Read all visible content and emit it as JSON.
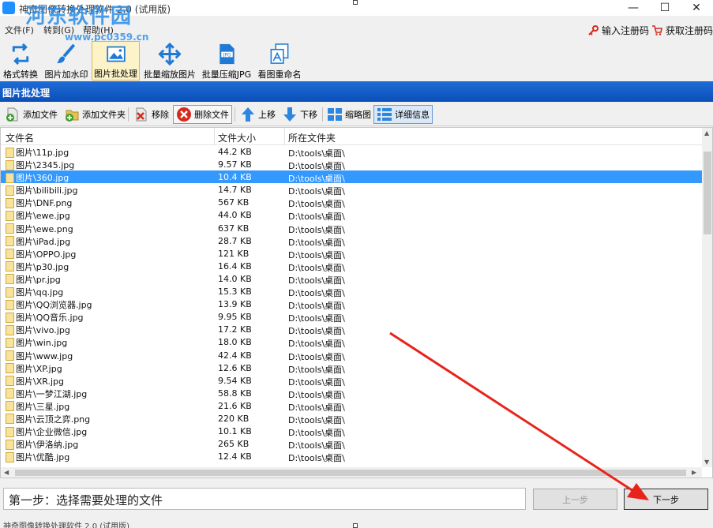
{
  "window": {
    "title": "神奇图像转换处理软件 2.0 (试用版)",
    "watermark_cn": "河东软件园",
    "watermark_url": "www.pc0359.cn",
    "minimize_glyph": "—",
    "maximize_glyph": "☐",
    "close_glyph": "✕"
  },
  "menu": {
    "items": [
      "文件(F)",
      "转到(G)",
      "帮助(H)"
    ],
    "register_label": "输入注册码",
    "buy_label": "获取注册码"
  },
  "toolbar": {
    "tools": [
      {
        "label": "格式转换",
        "icon": "format-convert-icon"
      },
      {
        "label": "图片加水印",
        "icon": "watermark-brush-icon"
      },
      {
        "label": "图片批处理",
        "icon": "batch-image-icon"
      },
      {
        "label": "批量缩放图片",
        "icon": "resize-arrows-icon"
      },
      {
        "label": "批量压缩JPG",
        "icon": "jpg-file-icon"
      },
      {
        "label": "看图重命名",
        "icon": "rename-images-icon"
      }
    ],
    "active_index": 2
  },
  "panel": {
    "title": "图片批处理"
  },
  "actions": {
    "add_file": "添加文件",
    "add_folder": "添加文件夹",
    "remove": "移除",
    "delete_file": "删除文件",
    "move_up": "上移",
    "move_down": "下移",
    "thumbnail": "缩略图",
    "details": "详细信息"
  },
  "table": {
    "columns": [
      "文件名",
      "文件大小",
      "所在文件夹"
    ],
    "selected_index": 2,
    "rows": [
      {
        "name": "图片\\11p.jpg",
        "size": "44.2 KB",
        "folder": "D:\\tools\\桌面\\"
      },
      {
        "name": "图片\\2345.jpg",
        "size": "9.57 KB",
        "folder": "D:\\tools\\桌面\\"
      },
      {
        "name": "图片\\360.jpg",
        "size": "10.4 KB",
        "folder": "D:\\tools\\桌面\\"
      },
      {
        "name": "图片\\bilibili.jpg",
        "size": "14.7 KB",
        "folder": "D:\\tools\\桌面\\"
      },
      {
        "name": "图片\\DNF.png",
        "size": "567 KB",
        "folder": "D:\\tools\\桌面\\"
      },
      {
        "name": "图片\\ewe.jpg",
        "size": "44.0 KB",
        "folder": "D:\\tools\\桌面\\"
      },
      {
        "name": "图片\\ewe.png",
        "size": "637 KB",
        "folder": "D:\\tools\\桌面\\"
      },
      {
        "name": "图片\\iPad.jpg",
        "size": "28.7 KB",
        "folder": "D:\\tools\\桌面\\"
      },
      {
        "name": "图片\\OPPO.jpg",
        "size": "121 KB",
        "folder": "D:\\tools\\桌面\\"
      },
      {
        "name": "图片\\p30.jpg",
        "size": "16.4 KB",
        "folder": "D:\\tools\\桌面\\"
      },
      {
        "name": "图片\\pr.jpg",
        "size": "14.0 KB",
        "folder": "D:\\tools\\桌面\\"
      },
      {
        "name": "图片\\qq.jpg",
        "size": "15.3 KB",
        "folder": "D:\\tools\\桌面\\"
      },
      {
        "name": "图片\\QQ浏览器.jpg",
        "size": "13.9 KB",
        "folder": "D:\\tools\\桌面\\"
      },
      {
        "name": "图片\\QQ音乐.jpg",
        "size": "9.95 KB",
        "folder": "D:\\tools\\桌面\\"
      },
      {
        "name": "图片\\vivo.jpg",
        "size": "17.2 KB",
        "folder": "D:\\tools\\桌面\\"
      },
      {
        "name": "图片\\win.jpg",
        "size": "18.0 KB",
        "folder": "D:\\tools\\桌面\\"
      },
      {
        "name": "图片\\www.jpg",
        "size": "42.4 KB",
        "folder": "D:\\tools\\桌面\\"
      },
      {
        "name": "图片\\XP.jpg",
        "size": "12.6 KB",
        "folder": "D:\\tools\\桌面\\"
      },
      {
        "name": "图片\\XR.jpg",
        "size": "9.54 KB",
        "folder": "D:\\tools\\桌面\\"
      },
      {
        "name": "图片\\一梦江湖.jpg",
        "size": "58.8 KB",
        "folder": "D:\\tools\\桌面\\"
      },
      {
        "name": "图片\\三星.jpg",
        "size": "21.6 KB",
        "folder": "D:\\tools\\桌面\\"
      },
      {
        "name": "图片\\云顶之弈.png",
        "size": "220 KB",
        "folder": "D:\\tools\\桌面\\"
      },
      {
        "name": "图片\\企业微信.jpg",
        "size": "10.1 KB",
        "folder": "D:\\tools\\桌面\\"
      },
      {
        "name": "图片\\伊洛纳.jpg",
        "size": "265 KB",
        "folder": "D:\\tools\\桌面\\"
      },
      {
        "name": "图片\\优酷.jpg",
        "size": "12.4 KB",
        "folder": "D:\\tools\\桌面\\"
      }
    ]
  },
  "footer": {
    "step_text": "第一步：选择需要处理的文件",
    "prev_label": "上一步",
    "next_label": "下一步",
    "status_text": "神奇图像转换处理软件 2.0 (试用版)"
  },
  "colors": {
    "panel_title_bg": "#0b4fb8",
    "selection": "#3399ff",
    "annotation_arrow": "#e8241a"
  }
}
